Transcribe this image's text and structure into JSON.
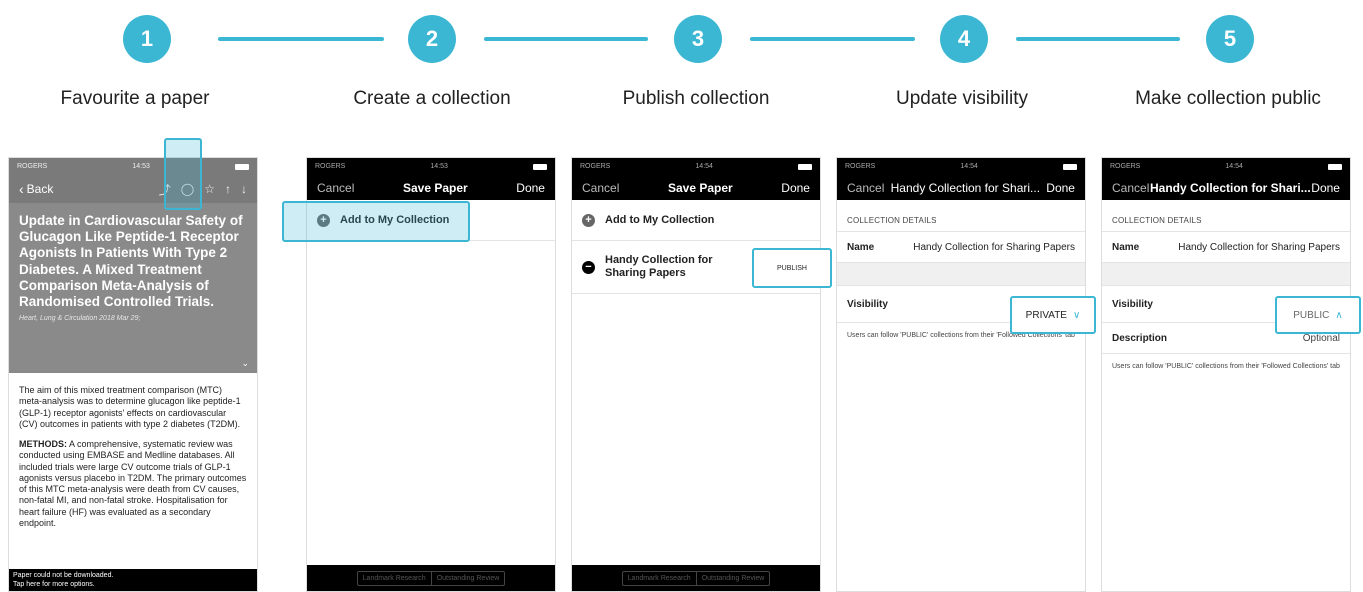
{
  "colors": {
    "accent": "#3bb7d3",
    "bar": "#000000",
    "article_header_bg": "#8a8a8a"
  },
  "steps": [
    {
      "number": "1",
      "label": "Favourite a paper"
    },
    {
      "number": "2",
      "label": "Create a collection"
    },
    {
      "number": "3",
      "label": "Publish collection"
    },
    {
      "number": "4",
      "label": "Update visibility"
    },
    {
      "number": "5",
      "label": "Make collection public"
    }
  ],
  "phone1": {
    "status": {
      "carrier": "ROGERS",
      "time": "14:53"
    },
    "nav": {
      "back": "Back",
      "icons": [
        "share-icon",
        "comment-icon",
        "star-icon",
        "thumbs-up-icon",
        "thumbs-down-icon"
      ]
    },
    "title": "Update in Cardiovascular Safety of Glucagon Like Peptide-1 Receptor Agonists In Patients With Type 2 Diabetes. A Mixed Treatment Comparison Meta-Analysis of Randomised Controlled Trials.",
    "citation": "Heart, Lung & Circulation 2018 Mar 29;",
    "abstract_p1": "The aim of this mixed treatment comparison (MTC) meta-analysis was to determine glucagon like peptide-1 (GLP-1) receptor agonists' effects on cardiovascular (CV) outcomes in patients with type 2 diabetes (T2DM).",
    "methods_label": "METHODS:",
    "abstract_p2": "A comprehensive, systematic review was conducted using EMBASE and Medline databases. All included trials were large CV outcome trials of GLP-1 agonists versus placebo in T2DM. The primary outcomes of this MTC meta-analysis were death from CV causes, non-fatal MI, and non-fatal stroke. Hospitalisation for heart failure (HF) was evaluated as a secondary endpoint.",
    "footer_line1": "Paper could not be downloaded.",
    "footer_line2": "Tap here for more options."
  },
  "phone2": {
    "status": {
      "carrier": "ROGERS",
      "time": "14:53"
    },
    "nav": {
      "cancel": "Cancel",
      "title": "Save Paper",
      "done": "Done"
    },
    "add_label": "Add to My Collection",
    "footer_tabs": [
      "Landmark Research",
      "Outstanding Review"
    ]
  },
  "phone3": {
    "status": {
      "carrier": "ROGERS",
      "time": "14:54"
    },
    "nav": {
      "cancel": "Cancel",
      "title": "Save Paper",
      "done": "Done"
    },
    "add_label": "Add to My Collection",
    "collection_name": "Handy Collection for Sharing Papers",
    "publish_label": "PUBLISH",
    "footer_tabs": [
      "Landmark Research",
      "Outstanding Review"
    ]
  },
  "phone4": {
    "status": {
      "carrier": "ROGERS",
      "time": "14:54"
    },
    "nav": {
      "cancel": "Cancel",
      "title": "Handy Collection for Shari...",
      "done": "Done"
    },
    "section": "COLLECTION DETAILS",
    "name_label": "Name",
    "name_value": "Handy Collection for Sharing Papers",
    "visibility_label": "Visibility",
    "visibility_value": "PRIVATE",
    "note": "Users can follow 'PUBLIC' collections from their 'Followed Collections' tab"
  },
  "phone5": {
    "status": {
      "carrier": "ROGERS",
      "time": "14:54"
    },
    "nav": {
      "cancel": "Cancel",
      "title": "Handy Collection for Shari...",
      "done": "Done"
    },
    "section": "COLLECTION DETAILS",
    "name_label": "Name",
    "name_value": "Handy Collection for Sharing Papers",
    "visibility_label": "Visibility",
    "visibility_value": "PUBLIC",
    "description_label": "Description",
    "description_value": "Optional",
    "note": "Users can follow 'PUBLIC' collections from their 'Followed Collections' tab"
  }
}
